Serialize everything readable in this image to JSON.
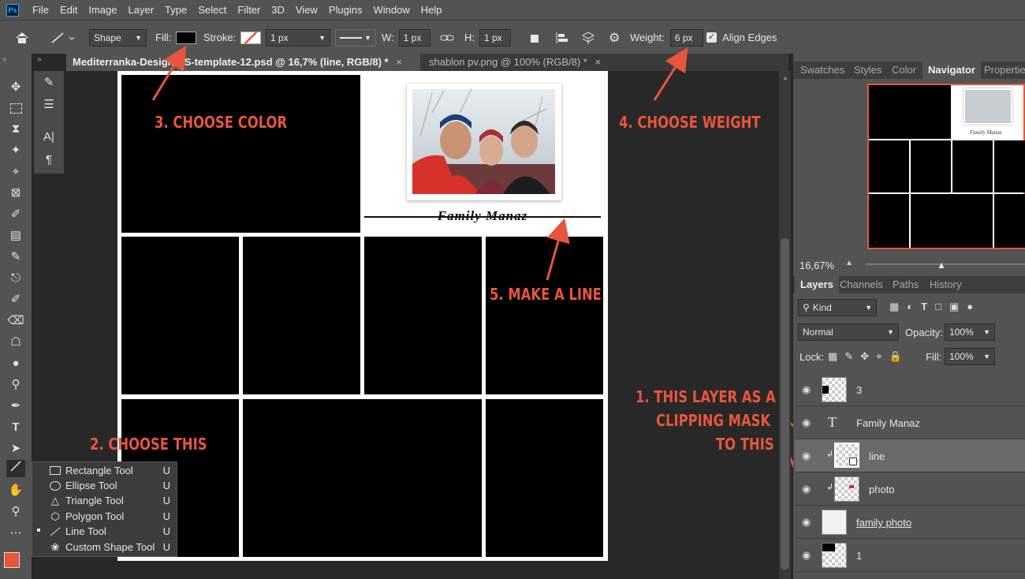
{
  "menu": [
    "File",
    "Edit",
    "Image",
    "Layer",
    "Type",
    "Select",
    "Filter",
    "3D",
    "View",
    "Plugins",
    "Window",
    "Help"
  ],
  "app_logo": "Ps",
  "options": {
    "mode": "Shape",
    "fill_label": "Fill:",
    "stroke_label": "Stroke:",
    "stroke_width": "1 px",
    "w_label": "W:",
    "w_value": "1 px",
    "h_label": "H:",
    "h_value": "1 px",
    "weight_label": "Weight:",
    "weight_value": "6 px",
    "align_edges": "Align Edges",
    "fill_color": "#000000"
  },
  "tabs": [
    {
      "label": "Mediterranka-Design-PS-template-12.psd @ 16,7% (line, RGB/8) *",
      "close": "×"
    },
    {
      "label": "shablon pv.png @ 100% (RGB/8) *",
      "close": "×"
    }
  ],
  "document": {
    "title_text": "Family Manaz"
  },
  "annotations": {
    "a1": "1. THIS LAYER AS A",
    "a1b": "CLIPPING MASK",
    "a1c": "TO THIS",
    "a2": "2. CHOOSE THIS",
    "a3": "3. CHOOSE COLOR",
    "a4": "4. CHOOSE WEIGHT",
    "a5": "5. MAKE A LINE",
    "color": "#e8553c"
  },
  "flyout": [
    {
      "label": "Rectangle Tool",
      "key": "U",
      "icon": "rectangle-icon"
    },
    {
      "label": "Ellipse Tool",
      "key": "U",
      "icon": "ellipse-icon"
    },
    {
      "label": "Triangle Tool",
      "key": "U",
      "icon": "triangle-icon"
    },
    {
      "label": "Polygon Tool",
      "key": "U",
      "icon": "polygon-icon"
    },
    {
      "label": "Line Tool",
      "key": "U",
      "icon": "line-icon",
      "selected": true
    },
    {
      "label": "Custom Shape Tool",
      "key": "U",
      "icon": "custom-shape-icon"
    }
  ],
  "panel_top_tabs": [
    "Swatches",
    "Styles",
    "Color",
    "Navigator",
    "Properties"
  ],
  "zoom": "16,67%",
  "panel_layer_tabs": [
    "Layers",
    "Channels",
    "Paths",
    "History"
  ],
  "layers_panel": {
    "kind": "Kind",
    "blend": "Normal",
    "opacity_label": "Opacity:",
    "opacity": "100%",
    "lock_label": "Lock:",
    "fill_label": "Fill:",
    "fill": "100%"
  },
  "layers": [
    {
      "name": "3",
      "type": "raster"
    },
    {
      "name": "Family Manaz",
      "type": "text"
    },
    {
      "name": "line",
      "type": "shape",
      "clipped": true,
      "selected": true
    },
    {
      "name": "photo",
      "type": "raster",
      "clipped": true
    },
    {
      "name": "family photo",
      "type": "raster"
    },
    {
      "name": "1",
      "type": "raster"
    }
  ],
  "foreground_color": "#e8553c"
}
